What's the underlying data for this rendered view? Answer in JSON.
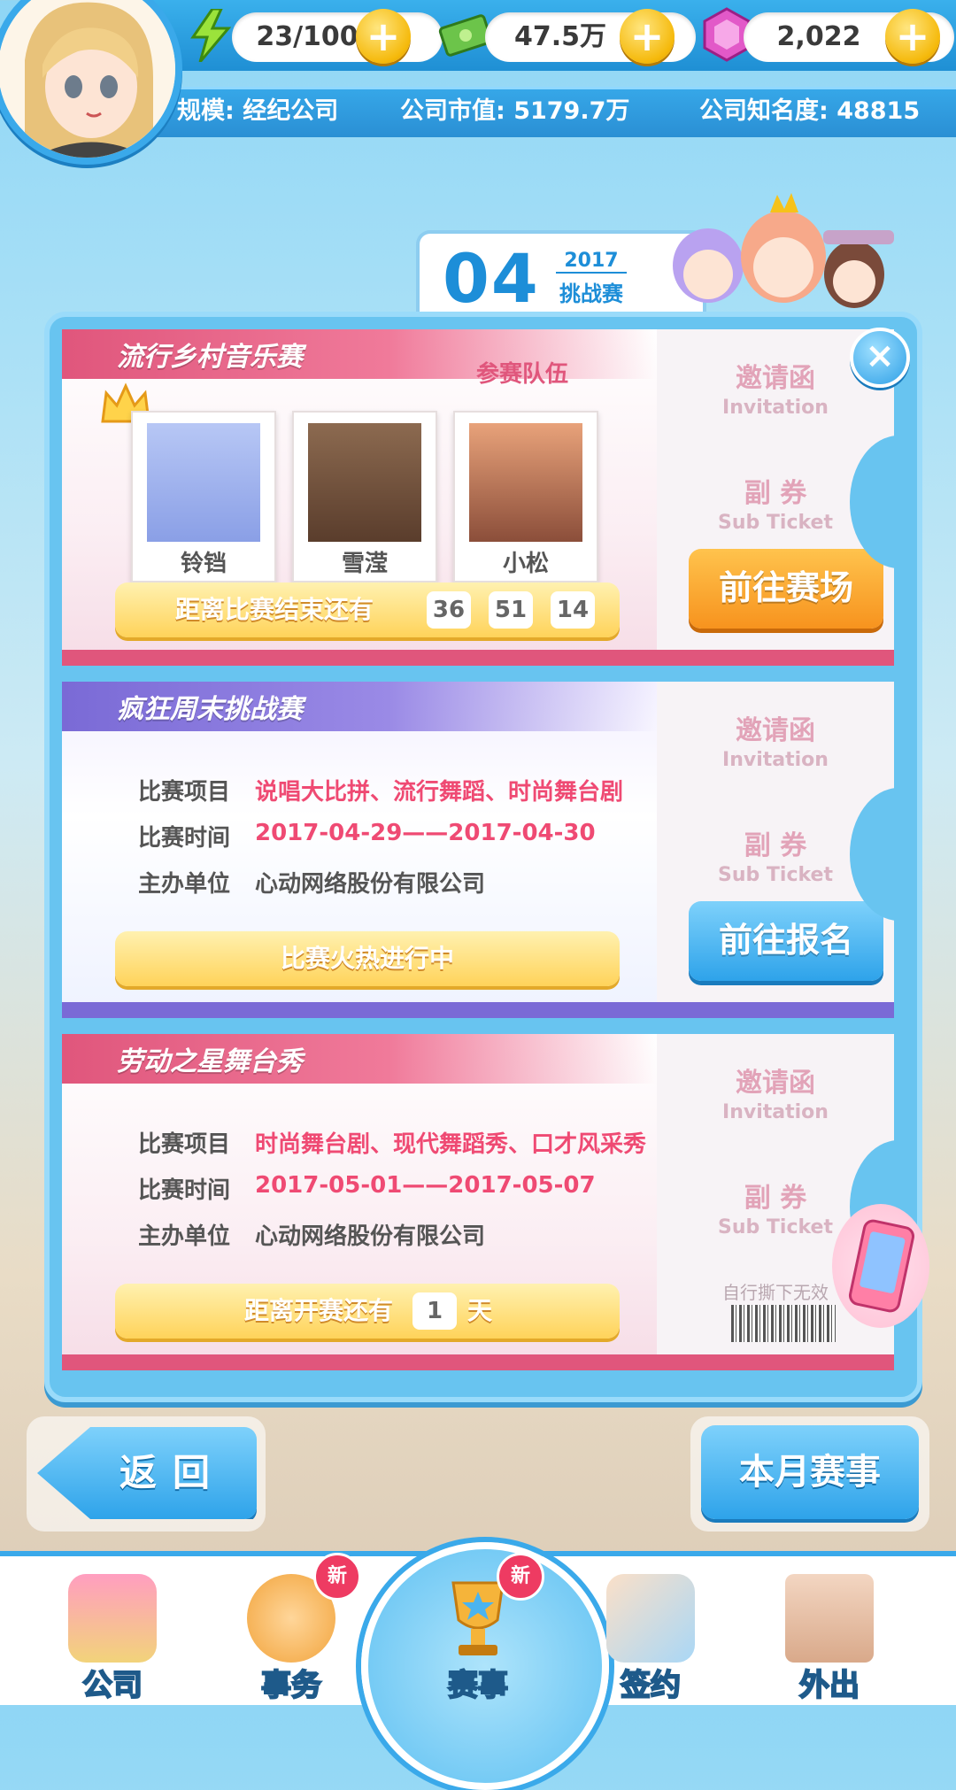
{
  "resources": {
    "stamina": "23/100",
    "money": "47.5万",
    "gems": "2,022",
    "plus_symbol": "+"
  },
  "company": {
    "scale": "规模: 经纪公司",
    "market_value": "公司市值: 5179.7万",
    "fame": "公司知名度: 48815"
  },
  "month_badge": {
    "number": "04",
    "year": "2017",
    "label": "挑战赛"
  },
  "close_symbol": "×",
  "stub": {
    "invitation_cn": "邀请函",
    "invitation_en": "Invitation",
    "sub_ticket_cn": "副 券",
    "sub_ticket_en": "Sub Ticket",
    "tear_note": "自行撕下无效"
  },
  "contests": [
    {
      "title": "流行乡村音乐赛",
      "team_label": "参赛队伍",
      "members": [
        "铃铛",
        "雪滢",
        "小松"
      ],
      "status_text": "距离比赛结束还有",
      "countdown": [
        "36",
        "51",
        "14"
      ],
      "button": "前往赛场"
    },
    {
      "title": "疯狂周末挑战赛",
      "labels": [
        "比赛项目",
        "比赛时间",
        "主办单位"
      ],
      "events": "说唱大比拼、流行舞蹈、时尚舞台剧",
      "time": "2017-04-29——2017-04-30",
      "organizer": "心动网络股份有限公司",
      "status_text": "比赛火热进行中",
      "button": "前往报名"
    },
    {
      "title": "劳动之星舞台秀",
      "labels": [
        "比赛项目",
        "比赛时间",
        "主办单位"
      ],
      "events": "时尚舞台剧、现代舞蹈秀、口才风采秀",
      "time": "2017-05-01——2017-05-07",
      "organizer": "心动网络股份有限公司",
      "status_prefix": "距离开赛还有",
      "days": "1",
      "status_suffix": "天"
    }
  ],
  "buttons": {
    "back": "返回",
    "this_month": "本月赛事"
  },
  "nav": {
    "items": [
      "公司",
      "事务",
      "赛事",
      "签约",
      "外出"
    ],
    "badge": "新"
  },
  "colors": {
    "accent_blue": "#2ea3ea",
    "pink_title": "#e0567c",
    "purple_title": "#7a6ad6",
    "orange_button": "#f7931e",
    "red_text": "#ef4a73"
  }
}
